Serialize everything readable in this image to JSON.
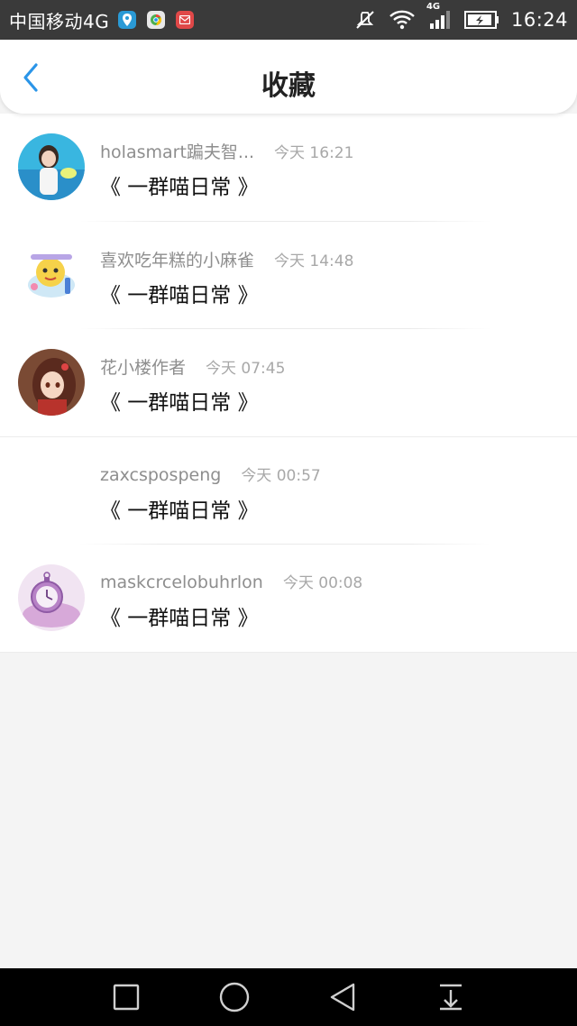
{
  "status_bar": {
    "carrier": "中国移动4G",
    "network_label": "4G",
    "time": "16:24",
    "app_badge_colors": [
      "#2a9ad6",
      "#e8e8e8",
      "#e04848"
    ]
  },
  "header": {
    "title": "收藏",
    "accent_color": "#2b95e8"
  },
  "favorites": [
    {
      "username": "holasmart蹁夫智...",
      "timestamp": "今天 16:21",
      "title": "《 一群喵日常 》",
      "avatar": "girl-photo"
    },
    {
      "username": "喜欢吃年糕的小麻雀",
      "timestamp": "今天 14:48",
      "title": "《 一群喵日常 》",
      "avatar": "cartoon-cat"
    },
    {
      "username": "花小楼作者",
      "timestamp": "今天 07:45",
      "title": "《 一群喵日常 》",
      "avatar": "anime-girl"
    },
    {
      "username": "zaxcspospeng",
      "timestamp": "今天 00:57",
      "title": "《 一群喵日常 》",
      "avatar": "none"
    },
    {
      "username": "maskcrcelobuhrlon",
      "timestamp": "今天 00:08",
      "title": "《 一群喵日常 》",
      "avatar": "pocket-watch"
    }
  ],
  "nav_bar": {
    "buttons": [
      "recent-apps",
      "home",
      "back",
      "notification-pull"
    ]
  }
}
